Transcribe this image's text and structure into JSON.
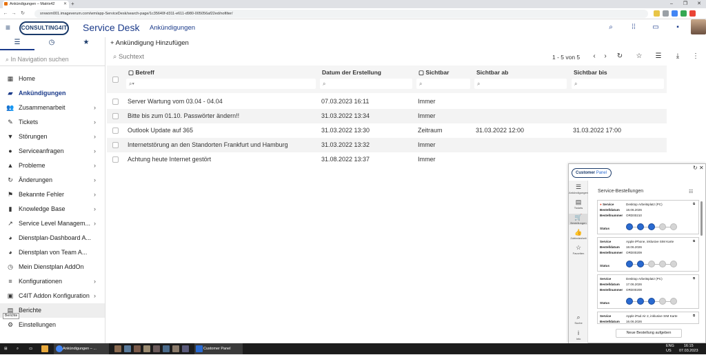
{
  "browser": {
    "tab_title": "Ankündigungen – Matrix42",
    "url": "srvwom001.imageverum.com/wm/app-ServiceDesk/search-page/1c35640f-d311-e611-d980-005056af22ed/nofilter/"
  },
  "header": {
    "logo_text": "CONSULTING4IT",
    "app_title": "Service Desk",
    "page": "Ankündigungen"
  },
  "sidebar": {
    "search_placeholder": "In Navigation suchen",
    "items": [
      {
        "label": "Home",
        "icon": "home-icon",
        "glyph": "▦"
      },
      {
        "label": "Ankündigungen",
        "icon": "announcement-icon",
        "glyph": "▰",
        "active": true
      },
      {
        "label": "Zusammenarbeit",
        "icon": "people-icon",
        "glyph": "👥",
        "chevron": true
      },
      {
        "label": "Tickets",
        "icon": "ticket-icon",
        "glyph": "✎",
        "chevron": true
      },
      {
        "label": "Störungen",
        "icon": "incident-icon",
        "glyph": "▼",
        "chevron": true
      },
      {
        "label": "Serviceanfragen",
        "icon": "service-request-icon",
        "glyph": "●",
        "chevron": true
      },
      {
        "label": "Probleme",
        "icon": "problem-icon",
        "glyph": "▲",
        "chevron": true
      },
      {
        "label": "Änderungen",
        "icon": "change-icon",
        "glyph": "↻",
        "chevron": true
      },
      {
        "label": "Bekannte Fehler",
        "icon": "known-error-icon",
        "glyph": "⚑",
        "chevron": true
      },
      {
        "label": "Knowledge Base",
        "icon": "book-icon",
        "glyph": "▮",
        "chevron": true
      },
      {
        "label": "Service Level Managem...",
        "icon": "trend-icon",
        "glyph": "↗",
        "chevron": true
      },
      {
        "label": "Dienstplan-Dashboard A...",
        "icon": "dashboard-icon",
        "glyph": "◕"
      },
      {
        "label": "Dienstplan von Team A...",
        "icon": "team-plan-icon",
        "glyph": "◕"
      },
      {
        "label": "Mein Dienstplan AddOn",
        "icon": "clock-icon",
        "glyph": "◷"
      },
      {
        "label": "Konfigurationen",
        "icon": "sliders-icon",
        "glyph": "≡",
        "chevron": true
      },
      {
        "label": "C4IT Addon Konfiguration",
        "icon": "addon-icon",
        "glyph": "▣",
        "chevron": true
      },
      {
        "label": "Berichte",
        "icon": "report-icon",
        "glyph": "▤",
        "hover": true
      },
      {
        "label": "Einstellungen",
        "icon": "gear-icon",
        "glyph": "⚙"
      }
    ],
    "tooltip": "Berichte"
  },
  "main": {
    "add_label": "Ankündigung Hinzufügen",
    "search_placeholder": "Suchtext",
    "pager": "1 - 5 von 5",
    "columns": [
      "Betreff",
      "Datum der Erstellung",
      "Sichtbar",
      "Sichtbar ab",
      "Sichtbar bis"
    ],
    "rows": [
      [
        "Server Wartung vom 03.04 - 04.04",
        "07.03.2023 16:11",
        "Immer",
        "",
        ""
      ],
      [
        "Bitte bis zum 01.10. Passwörter ändern!!",
        "31.03.2022 13:34",
        "Immer",
        "",
        ""
      ],
      [
        "Outlook Update auf 365",
        "31.03.2022 13:30",
        "Zeitraum",
        "31.03.2022 12:00",
        "31.03.2022 17:00"
      ],
      [
        "Internetstörung an den Standorten Frankfurt und Hamburg",
        "31.03.2022 13:32",
        "Immer",
        "",
        ""
      ],
      [
        "Achtung heute Internet gestört",
        "31.08.2022 13:37",
        "Immer",
        "",
        ""
      ]
    ]
  },
  "customer_panel": {
    "logo_a": "Customer",
    "logo_b": "Panel",
    "rail": [
      "Ankündigungen",
      "Tickets",
      "Bestellungen",
      "Zufriedenheit",
      "Favoriten",
      "Suche",
      "Info"
    ],
    "title": "Service-Bestellungen",
    "labels": {
      "service": "Service",
      "date": "Bestelldatum",
      "number": "Bestellnummer",
      "status": "Status"
    },
    "orders": [
      {
        "service": "Desktop Arbeitsplatz (PC)",
        "date": "18.06.2026",
        "number": "ORD00210",
        "progress": 3
      },
      {
        "service": "Apple iPhone, inklusive SIM Karte",
        "date": "18.06.2026",
        "number": "ORD00209",
        "progress": 2
      },
      {
        "service": "Desktop Arbeitsplatz (PC)",
        "date": "17.06.2026",
        "number": "ORD00208",
        "progress": 3
      },
      {
        "service": "Apple iPad Air 2, inklusive SIM Karte",
        "date": "16.06.2026",
        "number": "",
        "progress": 0
      }
    ],
    "new_order": "Neue Bestellung aufgeben"
  },
  "taskbar": {
    "chrome_label": "Ankündigungen – ...",
    "panel_label": "Customer Panel",
    "lang": "ENG",
    "region": "US",
    "time": "16:15",
    "date": "07.03.2023"
  }
}
